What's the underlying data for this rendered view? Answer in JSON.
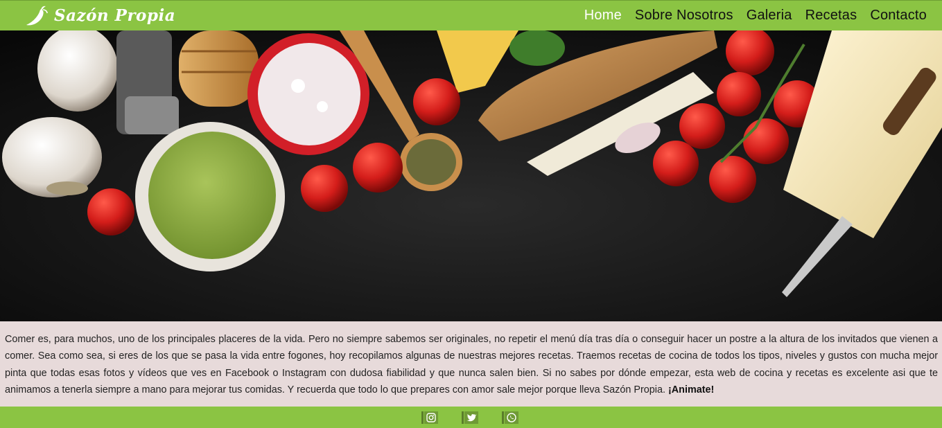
{
  "brand": {
    "name": "Sazón Propia",
    "logo_icon": "chili-pepper-icon"
  },
  "nav": {
    "items": [
      {
        "label": "Home",
        "active": true
      },
      {
        "label": "Sobre Nosotros",
        "active": false
      },
      {
        "label": "Galeria",
        "active": false
      },
      {
        "label": "Recetas",
        "active": false
      },
      {
        "label": "Contacto",
        "active": false
      }
    ]
  },
  "hero": {
    "description": "food-ingredients-banner"
  },
  "intro": {
    "text": "Comer es, para muchos, uno de los principales placeres de la vida. Pero no siempre sabemos ser originales, no repetir el menú día tras día o conseguir hacer un postre a la altura de los invitados que vienen a comer. Sea como sea, si eres de los que se pasa la vida entre fogones, hoy recopilamos algunas de nuestras mejores recetas. Traemos recetas de cocina de todos los tipos, niveles y gustos con mucha mejor pinta que todas esas fotos y vídeos que ves en Facebook o Instagram con dudosa fiabilidad y que nunca salen bien. Si no sabes por dónde empezar, esta web de cocina y recetas es excelente asi que te animamos a tenerla siempre a mano para mejorar tus comidas. Y recuerda que todo lo que prepares con amor sale mejor porque lleva Sazón Propia.",
    "cta": "¡Animate!"
  },
  "footer": {
    "social": [
      {
        "icon": "instagram-icon"
      },
      {
        "icon": "twitter-icon"
      },
      {
        "icon": "whatsapp-icon"
      }
    ]
  },
  "colors": {
    "accent": "#8bc443",
    "intro_bg": "#e7dada",
    "hero_bg": "#121212"
  }
}
